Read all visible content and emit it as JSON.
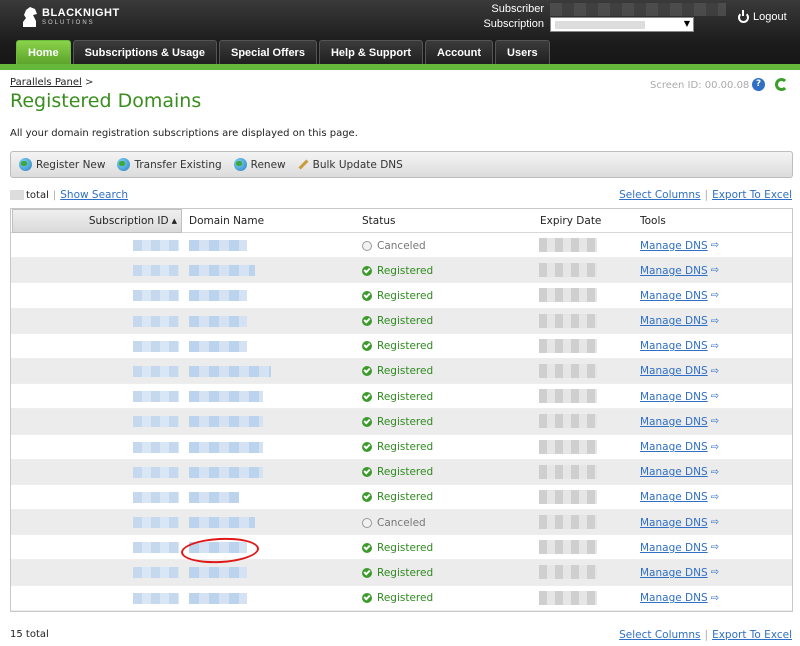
{
  "header": {
    "logo_text": "BLACKNIGHT",
    "logo_sub": "SOLUTIONS",
    "subscriber_label": "Subscriber",
    "subscription_label": "Subscription",
    "logout_label": "Logout"
  },
  "tabs": [
    {
      "label": "Home",
      "active": true
    },
    {
      "label": "Subscriptions & Usage",
      "active": false
    },
    {
      "label": "Special Offers",
      "active": false
    },
    {
      "label": "Help & Support",
      "active": false
    },
    {
      "label": "Account",
      "active": false
    },
    {
      "label": "Users",
      "active": false
    }
  ],
  "breadcrumb": {
    "link": "Parallels Panel",
    "sep": ">"
  },
  "page_title": "Registered Domains",
  "screen_id": "Screen ID:  00.00.08",
  "description": "All your domain registration subscriptions are displayed on this page.",
  "toolbar": {
    "register_new": "Register New",
    "transfer_existing": "Transfer Existing",
    "renew": "Renew",
    "bulk_update_dns": "Bulk Update DNS"
  },
  "list_controls": {
    "total_suffix": "total",
    "show_search": "Show Search",
    "select_columns": "Select Columns",
    "export_to_excel": "Export To Excel"
  },
  "table": {
    "columns": [
      "Subscription ID",
      "Domain Name",
      "Status",
      "Expiry Date",
      "Tools"
    ],
    "tool_label": "Manage DNS",
    "rows": [
      {
        "status": "Canceled"
      },
      {
        "status": "Registered"
      },
      {
        "status": "Registered"
      },
      {
        "status": "Registered"
      },
      {
        "status": "Registered"
      },
      {
        "status": "Registered"
      },
      {
        "status": "Registered"
      },
      {
        "status": "Registered"
      },
      {
        "status": "Registered"
      },
      {
        "status": "Registered"
      },
      {
        "status": "Registered"
      },
      {
        "status": "Canceled"
      },
      {
        "status": "Registered"
      },
      {
        "status": "Registered"
      },
      {
        "status": "Registered"
      }
    ]
  },
  "footer": {
    "total": "15 total"
  },
  "colors": {
    "accent_green": "#3a8e1e",
    "link_blue": "#2f6fc5",
    "tab_active": "#66b83a"
  }
}
